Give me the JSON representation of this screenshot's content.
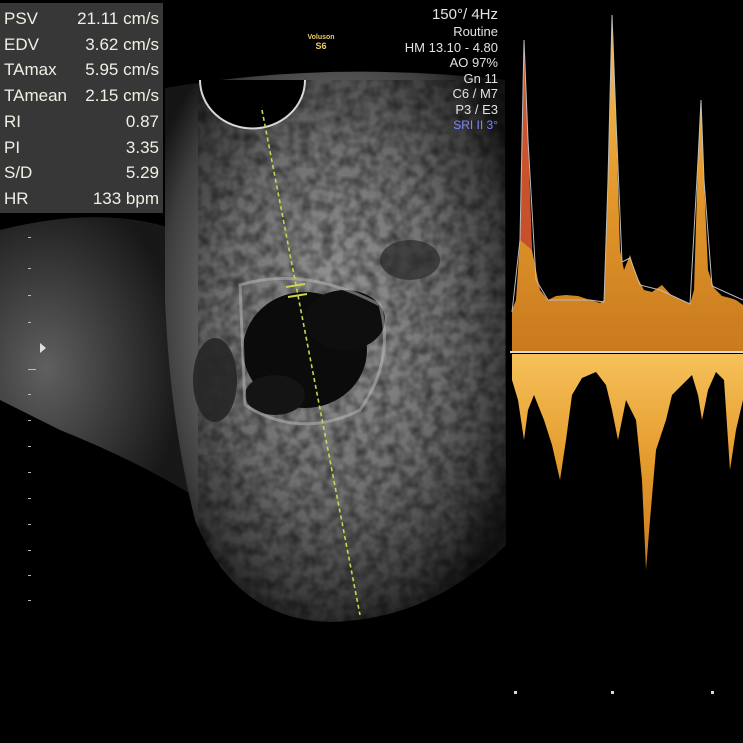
{
  "measurements": {
    "rows": [
      {
        "label": "PSV",
        "value": "21.11 cm/s"
      },
      {
        "label": "EDV",
        "value": "3.62 cm/s"
      },
      {
        "label": "TAmax",
        "value": "5.95 cm/s"
      },
      {
        "label": "TAmean",
        "value": "2.15 cm/s"
      },
      {
        "label": "RI",
        "value": "0.87"
      },
      {
        "label": "PI",
        "value": "3.35"
      },
      {
        "label": "S/D",
        "value": "5.29"
      },
      {
        "label": "HR",
        "value": "133 bpm"
      }
    ]
  },
  "scan_params": {
    "angle_rate": "150°/ 4Hz",
    "preset": "Routine",
    "harmonic": "HM  13.10 - 4.80",
    "acoustic_output": "AO 97%",
    "gain": "Gn  11",
    "cri_map": "C6 / M7",
    "persistence": "P3 / E3",
    "sri": "SRI II 3°"
  },
  "logo": {
    "brand": "Voluson",
    "model": "S6"
  },
  "colors": {
    "measure_text": "#f1efe4",
    "doppler_waveform": "#e7a93c",
    "sample_line": "#c9d64a",
    "sri_text": "#7b86ff",
    "logo": "#e8cf63"
  }
}
